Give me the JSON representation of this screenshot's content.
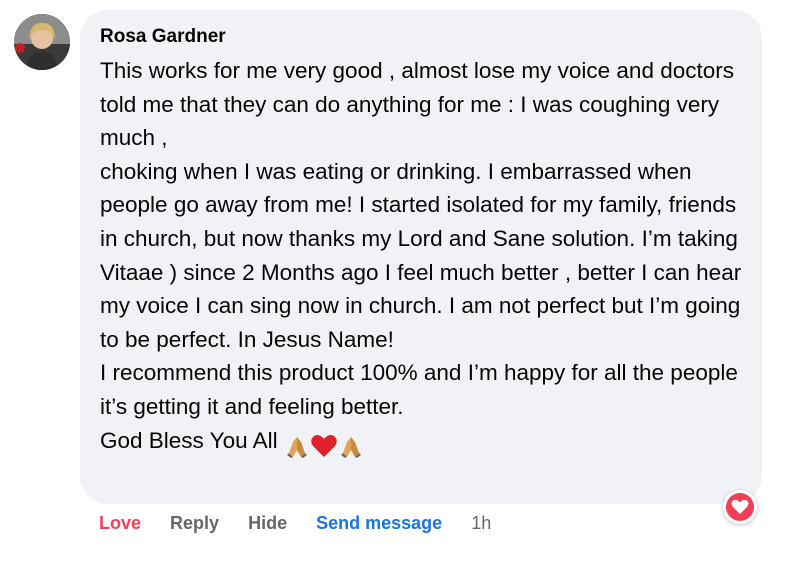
{
  "comment": {
    "author": "Rosa Gardner",
    "paragraphs": [
      "This works for me very good , almost lose my voice and doctors told me that they can do anything for me : I was coughing very much ,",
      "choking when I was eating or drinking. I embarrassed when people go away from me! I started isolated for my family, friends in church, but now thanks my Lord and Sane solution. I’m taking Vitaae ) since 2 Months ago I feel much better , better I can hear my voice I can sing now in church. I am not perfect but I’m going to be perfect. In Jesus Name!",
      "I recommend this product 100% and I’m happy for all the people it’s getting it and feeling better."
    ],
    "closing": "God Bless You All",
    "closing_emojis": [
      "folded-hands-icon",
      "red-heart-icon",
      "folded-hands-icon"
    ]
  },
  "reaction": {
    "icon": "love-heart-icon",
    "color": "#f33e58"
  },
  "actions": {
    "love": "Love",
    "reply": "Reply",
    "hide": "Hide",
    "send_message": "Send message",
    "time": "1h"
  },
  "colors": {
    "bubble": "#f0f2f5",
    "love": "#f33e58",
    "link": "#1b74e4",
    "muted": "#65676b"
  }
}
